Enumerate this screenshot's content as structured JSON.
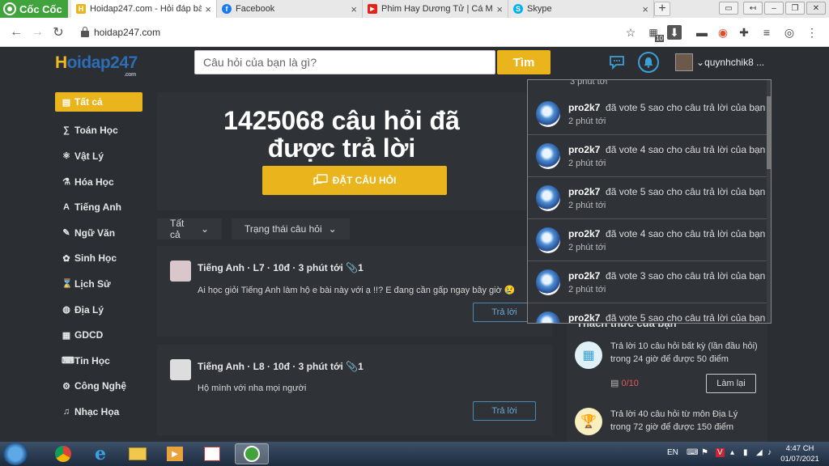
{
  "browser": {
    "brand": "Cốc Cốc",
    "tabs": [
      {
        "title": "Hoidap247.com - Hỏi đáp bà",
        "icon": "hoidap-favicon",
        "color": "#eab51c",
        "glyph": "H",
        "active": true
      },
      {
        "title": "Facebook",
        "icon": "facebook-favicon",
        "color": "#1877f2",
        "glyph": "f",
        "active": false
      },
      {
        "title": "Phim Hay Dương Tử | Cá Mự",
        "icon": "youtube-favicon",
        "color": "#e62117",
        "glyph": "▶",
        "active": false
      },
      {
        "title": "Skype",
        "icon": "skype-favicon",
        "color": "#00aff0",
        "glyph": "S",
        "active": false
      }
    ],
    "new_tab": "+",
    "url": "hoidap247.com",
    "ext_badge": "10"
  },
  "header": {
    "logo": {
      "h": "H",
      "rest": "oidap247",
      "suffix": ".com"
    },
    "search_placeholder": "Câu hỏi của bạn là gì?",
    "search_button": "Tìm",
    "username": "quynhchik8 ..."
  },
  "sidebar": {
    "items": [
      {
        "label": "Tất cả",
        "icon": "▤",
        "active": true
      },
      {
        "label": "Toán Học",
        "icon": "∑"
      },
      {
        "label": "Vật Lý",
        "icon": "⚛"
      },
      {
        "label": "Hóa Học",
        "icon": "⚗"
      },
      {
        "label": "Tiếng Anh",
        "icon": "A"
      },
      {
        "label": "Ngữ Văn",
        "icon": "✎"
      },
      {
        "label": "Sinh Học",
        "icon": "✿"
      },
      {
        "label": "Lịch Sử",
        "icon": "⌛"
      },
      {
        "label": "Địa Lý",
        "icon": "◍"
      },
      {
        "label": "GDCD",
        "icon": "▦"
      },
      {
        "label": "Tin Học",
        "icon": "⌨"
      },
      {
        "label": "Công Nghệ",
        "icon": "⚙"
      },
      {
        "label": "Nhạc Họa",
        "icon": "♫"
      }
    ]
  },
  "hero": {
    "line1": "1425068 câu hỏi đã",
    "line2": "được trả lời",
    "ask_button": "ĐẶT CÂU HỎI"
  },
  "filters": {
    "all": "Tất cả",
    "status": "Trạng thái câu hỏi"
  },
  "questions": [
    {
      "meta": "Tiếng Anh · L7 · 10đ · 3 phút tới 📎1",
      "text": "Ai học giỏi Tiếng Anh làm hộ e bài này với ạ !!? E đang cần gấp ngay bây giờ 😢",
      "reply": "Trả lời"
    },
    {
      "meta": "Tiếng Anh · L8 · 10đ · 3 phút tới 📎1",
      "text": "Hộ mình với nha mọi người",
      "reply": "Trả lời"
    }
  ],
  "notifications": {
    "clipped_time": "3 phút tới",
    "items": [
      {
        "user": "pro2k7",
        "action": "đã vote 5 sao cho câu trả lời của bạn",
        "time": "2 phút tới"
      },
      {
        "user": "pro2k7",
        "action": "đã vote 4 sao cho câu trả lời của bạn",
        "time": "2 phút tới"
      },
      {
        "user": "pro2k7",
        "action": "đã vote 5 sao cho câu trả lời của bạn",
        "time": "2 phút tới"
      },
      {
        "user": "pro2k7",
        "action": "đã vote 4 sao cho câu trả lời của bạn",
        "time": "2 phút tới"
      },
      {
        "user": "pro2k7",
        "action": "đã vote 3 sao cho câu trả lời của bạn",
        "time": "2 phút tới"
      },
      {
        "user": "pro2k7",
        "action": "đã vote 5 sao cho câu trả lời của bạn",
        "time": ""
      }
    ]
  },
  "challenge": {
    "title": "Thách thức của bạn",
    "c1_line1": "Trả lời 10 câu hỏi  bất kỳ (lần đầu hỏi)",
    "c1_line2": "trong 24 giờ để được 50 điểm",
    "c1_progress": "0/10",
    "c1_button": "Làm lại",
    "c2_line1": "Trả lời 40 câu hỏi  từ môn Địa Lý",
    "c2_line2": "trong 72 giờ để được 150 điểm"
  },
  "taskbar": {
    "lang": "EN",
    "time": "4:47 CH",
    "date": "01/07/2021"
  }
}
